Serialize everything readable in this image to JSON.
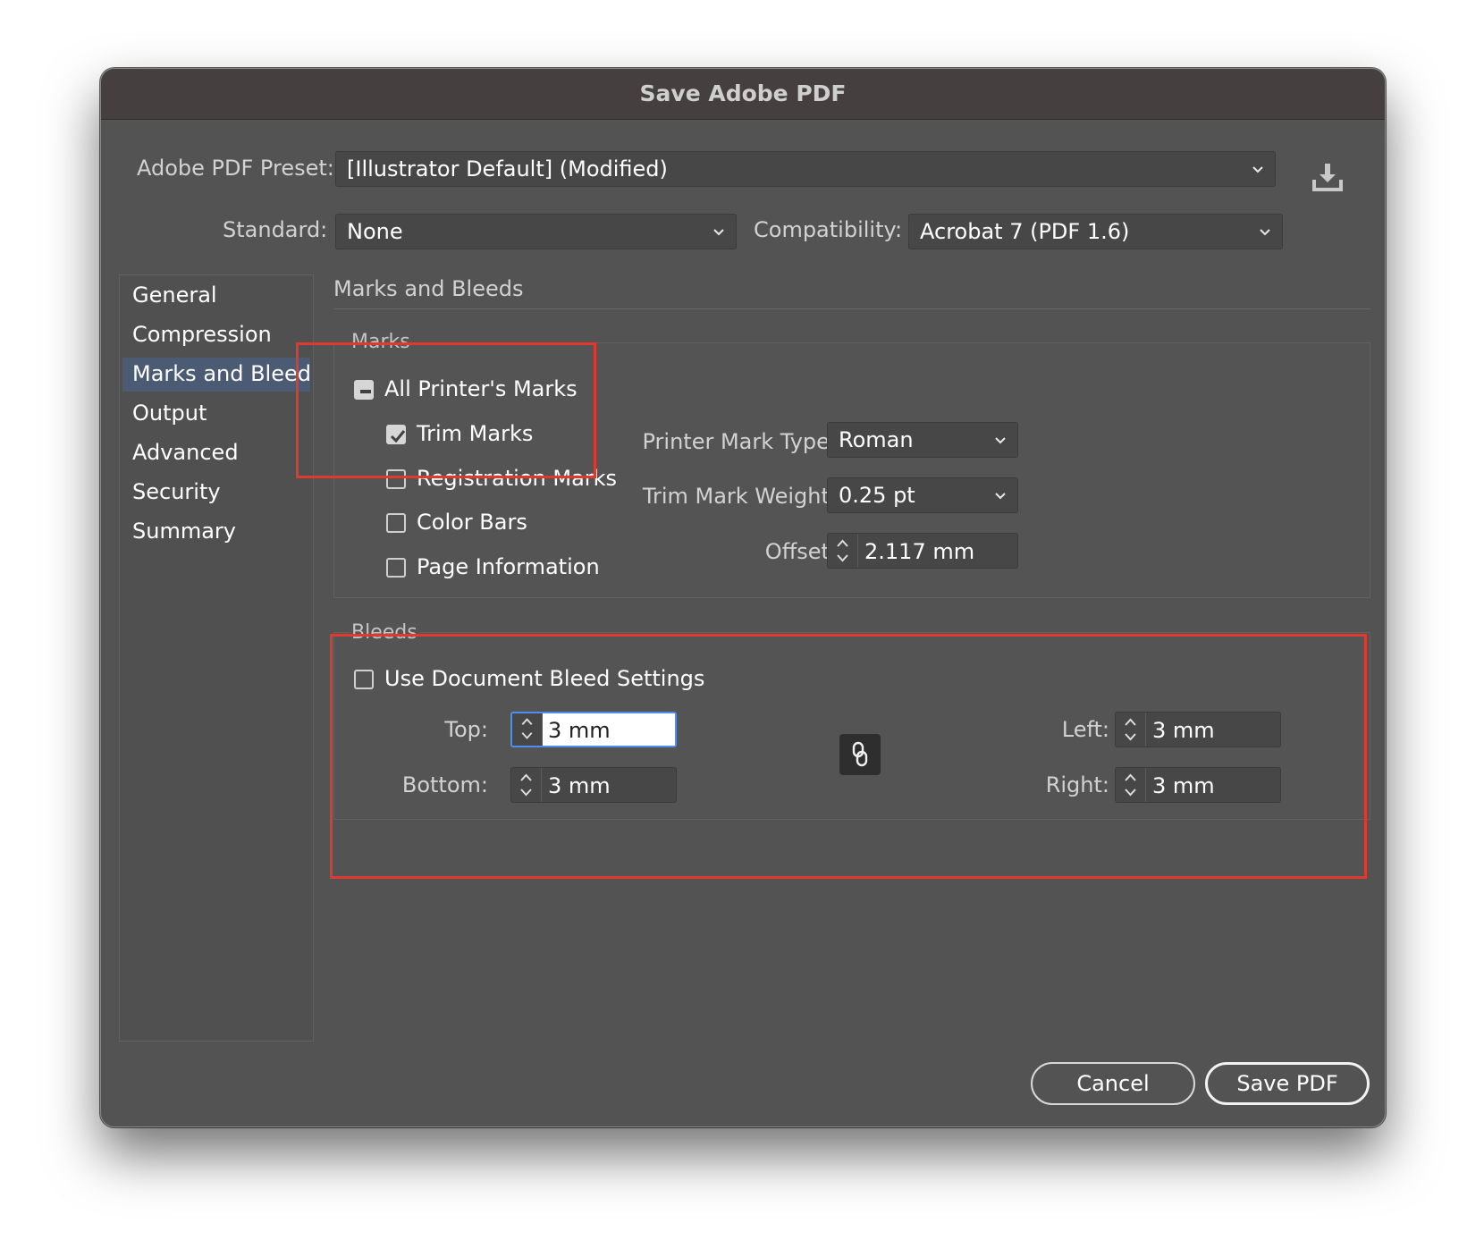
{
  "window": {
    "title": "Save Adobe PDF"
  },
  "preset": {
    "label": "Adobe PDF Preset:",
    "value": "[Illustrator Default] (Modified)"
  },
  "standard": {
    "label": "Standard:",
    "value": "None"
  },
  "compatibility": {
    "label": "Compatibility:",
    "value": "Acrobat 7 (PDF 1.6)"
  },
  "icons": {
    "save_preset": "download-icon",
    "dropdown": "chevron-down-icon",
    "stepper": "stepper-arrows-icon",
    "constrain": "chain-link-icon"
  },
  "sidebar": {
    "items": [
      {
        "label": "General"
      },
      {
        "label": "Compression"
      },
      {
        "label": "Marks and Bleeds",
        "selected": true
      },
      {
        "label": "Output"
      },
      {
        "label": "Advanced"
      },
      {
        "label": "Security"
      },
      {
        "label": "Summary"
      }
    ]
  },
  "section": {
    "title": "Marks and Bleeds"
  },
  "marks": {
    "group_title": "Marks",
    "all_printers_marks": {
      "label": "All Printer's Marks",
      "state": "mixed"
    },
    "trim_marks": {
      "label": "Trim Marks",
      "checked": true
    },
    "registration_marks": {
      "label": "Registration Marks",
      "checked": false
    },
    "color_bars": {
      "label": "Color Bars",
      "checked": false
    },
    "page_information": {
      "label": "Page Information",
      "checked": false
    },
    "printer_mark_type": {
      "label": "Printer Mark Type:",
      "value": "Roman"
    },
    "trim_mark_weight": {
      "label": "Trim Mark Weight:",
      "value": "0.25 pt"
    },
    "offset": {
      "label": "Offset:",
      "value": "2.117 mm"
    }
  },
  "bleeds": {
    "group_title": "Bleeds",
    "use_document": {
      "label": "Use Document Bleed Settings",
      "checked": false
    },
    "top": {
      "label": "Top:",
      "value": "3 mm"
    },
    "bottom": {
      "label": "Bottom:",
      "value": "3 mm"
    },
    "left": {
      "label": "Left:",
      "value": "3 mm"
    },
    "right": {
      "label": "Right:",
      "value": "3 mm"
    }
  },
  "buttons": {
    "cancel": "Cancel",
    "save": "Save PDF"
  },
  "colors": {
    "dialog_bg": "#535353",
    "titlebar_bg": "#463f3f",
    "selected_item": "#4b5b74",
    "focus_ring": "#4d8ef0",
    "annotation_red": "#e03a2f"
  }
}
